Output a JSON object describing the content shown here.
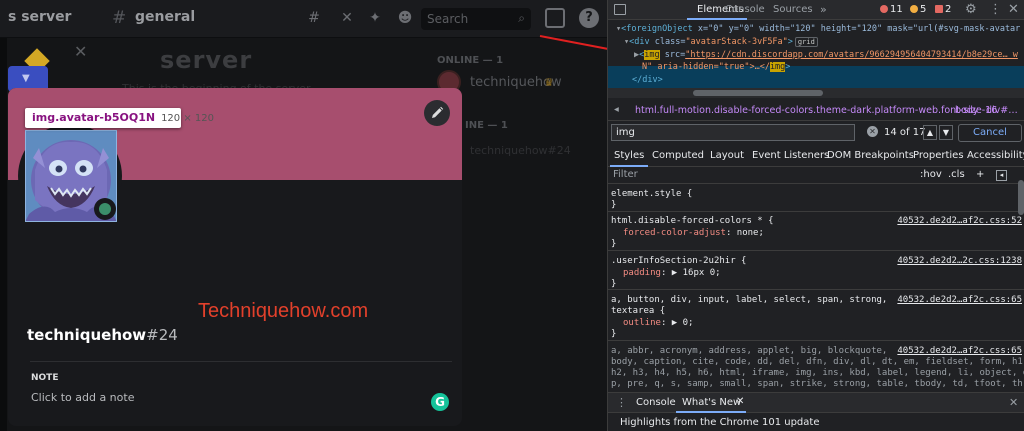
{
  "discord": {
    "server_name": "s server",
    "channel_name": "general",
    "search_placeholder": "Search",
    "help_label": "?",
    "bg_title": "server",
    "bg_faded": "This is the beginning of the server.",
    "member_section_1": "ONLINE — 1",
    "member_name": "techniquehow",
    "member_crown": "♛",
    "member_section_2": "INE — 1",
    "member_faded": "techniquehow#24",
    "profile": {
      "username": "techniquehow",
      "discriminator": "#24",
      "note_label": "NOTE",
      "note_placeholder": "Click to add a note",
      "banner_color": "#a74e6e",
      "status_color": "#3b8f6a"
    },
    "tooltip": {
      "tag": "img.avatar-b5OQ1N",
      "size": "120 × 120"
    },
    "watermark": "Techniquehow.com",
    "grammarly_label": "G"
  },
  "devtools": {
    "tabs": [
      "Elements",
      "Console",
      "Sources"
    ],
    "more": "»",
    "errors": "11",
    "warnings": "5",
    "issues": "2",
    "dom": {
      "line1_tag": "<foreignObject",
      "line1_attrs": " x=\"0\" y=\"0\" width=\"120\" height=\"120\" mask=\"url(#svg-mask-avatar",
      "line2_tag": "<div",
      "line2_attr": " class=",
      "line2_val": "\"avatarStack-3vF5Fa\"",
      "line2_close": ">",
      "grid_badge": "grid",
      "line3_open": "<",
      "line3_img": "img",
      "line3_src_attr": " src=",
      "line3_url": "\"https://cdn.discordapp.com/avatars/966294956404793414/b8e29ce… w",
      "line4_text": "N\" aria-hidden=\"true\">…</",
      "line4_img": "img",
      "line4_close": ">",
      "line5": "</div>"
    },
    "breadcrumbs": {
      "path": "html.full-motion.disable-forced-colors.theme-dark.platform-web.font-size-16",
      "body": "body",
      "div": "div#…"
    },
    "search": {
      "query": "img",
      "count": "14 of 17",
      "cancel": "Cancel"
    },
    "subtabs": [
      "Styles",
      "Computed",
      "Layout",
      "Event Listeners",
      "DOM Breakpoints",
      "Properties",
      "Accessibility"
    ],
    "filter_placeholder": "Filter",
    "filter_hov": ":hov",
    "filter_cls": ".cls",
    "filter_plus": "+",
    "styles": {
      "r1_selector": "element.style {",
      "r1_close": "}",
      "r2_selector": "html.disable-forced-colors * {",
      "r2_src": "40532.de2d2…af2c.css:52",
      "r2_prop": "forced-color-adjust",
      "r2_val": ": none;",
      "r2_close": "}",
      "r3_selector": ".userInfoSection-2u2hir {",
      "r3_src": "40532.de2d2…2c.css:1238",
      "r3_prop": "padding",
      "r3_val": ": ▶ 16px 0;",
      "r3_close": "}",
      "r4_selector": "a, button, div, input, label, select, span, strong,",
      "r4_selector2": "textarea {",
      "r4_src": "40532.de2d2…af2c.css:65",
      "r4_prop": "outline",
      "r4_val": ": ▶ 0;",
      "r4_close": "}",
      "r5_line1": "a, abbr, acronym, address, applet, big, blockquote,",
      "r5_src": "40532.de2d2…af2c.css:65",
      "r5_line2": "body, caption, cite, code, dd, del, dfn, div, dl, dt, em, fieldset, form, h1,",
      "r5_line3": "h2, h3, h4, h5, h6, html, iframe, img, ins, kbd, label, legend, li, object, ol,",
      "r5_line4": "p, pre, q, s, samp, small, span, strike, strong, table, tbody, td, tfoot, th,"
    },
    "drawer": {
      "tabs": [
        "Console",
        "What's New"
      ],
      "close": "✕",
      "content": "Highlights from the Chrome 101 update"
    }
  }
}
